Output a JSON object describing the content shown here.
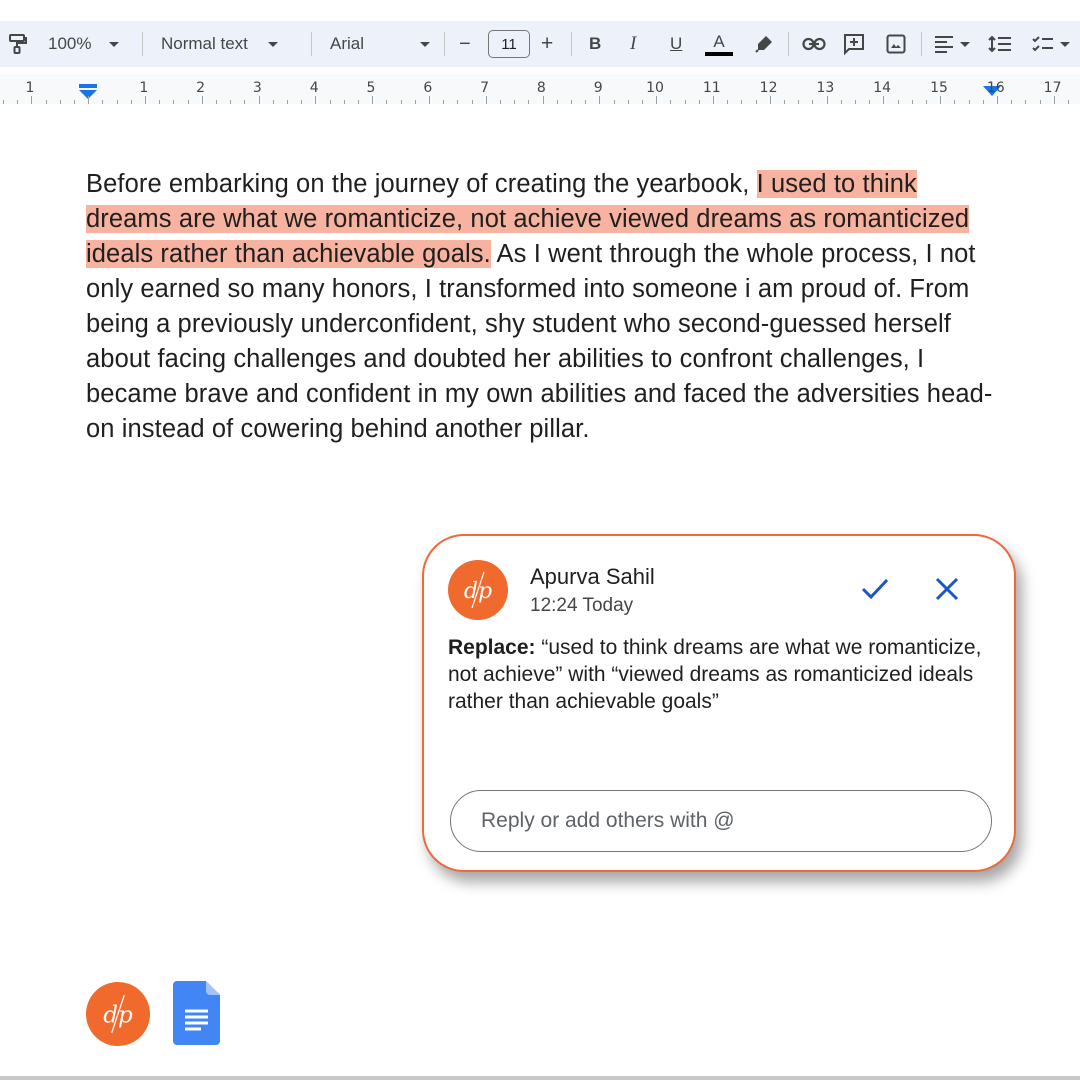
{
  "toolbar": {
    "zoom": "100%",
    "style": "Normal text",
    "font": "Arial",
    "font_size": "11",
    "decrease_label": "−",
    "increase_label": "+",
    "bold_label": "B",
    "italic_label": "I",
    "underline_label": "U",
    "text_color_label": "A",
    "text_color": "#000000",
    "icons": [
      "paint-format-icon",
      "bold-icon",
      "italic-icon",
      "underline-icon",
      "text-color-icon",
      "highlight-icon",
      "link-icon",
      "add-comment-icon",
      "insert-image-icon",
      "align-icon",
      "line-spacing-icon",
      "checklist-icon"
    ]
  },
  "ruler": {
    "labels": [
      "1",
      "1",
      "2",
      "3",
      "4",
      "5",
      "6",
      "7",
      "8",
      "9",
      "10",
      "11",
      "12",
      "13",
      "14",
      "15",
      "16",
      "17"
    ],
    "accent": "#1a73e8"
  },
  "document": {
    "text_before": "Before embarking on the journey of creating the yearbook, ",
    "highlighted": "I used to think dreams are what we romanticize, not achieve viewed dreams as romanticized ideals rather than achievable goals.",
    "text_after": " As I went through the whole process, I not only earned so many honors, I transformed into someone i am proud of. From being a previously underconfident, shy student who second-guessed herself about facing challenges and doubted her abilities to confront challenges, I became brave and confident in my own abilities and faced the adversities head-on instead of cowering behind another pillar.",
    "highlight_color": "#f8b3a0"
  },
  "comment": {
    "author": "Apurva Sahil",
    "time": "12:24 Today",
    "avatar_initials": "dp",
    "body_label": "Replace:",
    "body_text": " “used to think dreams are what we romanticize, not achieve” with “viewed dreams as romanticized ideals rather than achievable goals”",
    "accept_icon": "check-icon",
    "reject_icon": "close-icon",
    "reply_placeholder": "Reply or add others with @",
    "border_color": "#ec6a3b",
    "action_color": "#1a56c4"
  },
  "footer": {
    "logos": [
      "dp-logo",
      "google-docs-logo"
    ],
    "logo_initials": "dp"
  }
}
